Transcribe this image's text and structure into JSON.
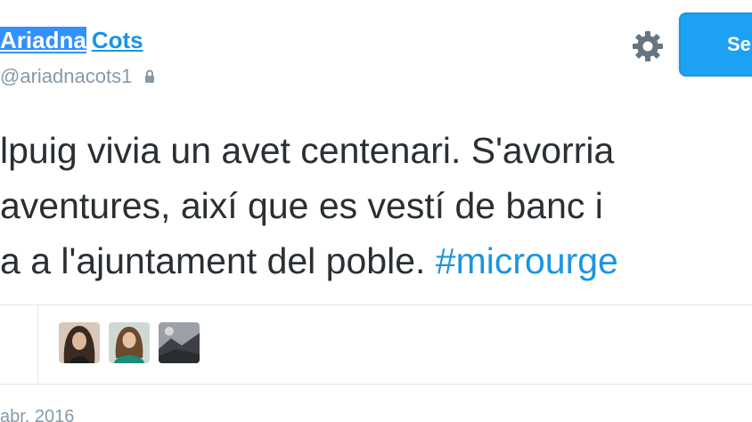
{
  "header": {
    "display_name_first": "Ariadna",
    "display_name_last": "Cots",
    "handle": "@ariadnacots1",
    "follow_label": "Se"
  },
  "tweet": {
    "lines": [
      "lpuig vivia un avet centenari. S'avorria",
      " aventures, així que es vestí de banc i",
      "a a l'ajuntament del poble. "
    ],
    "hashtag": "#microurge"
  },
  "likers": [
    {
      "name": "avatar-1",
      "colors": [
        "#3a2a20",
        "#e0b89a"
      ]
    },
    {
      "name": "avatar-2",
      "colors": [
        "#6b4a2e",
        "#1e8a7a"
      ]
    },
    {
      "name": "avatar-3",
      "colors": [
        "#9aa0a6",
        "#3d4145"
      ]
    }
  ],
  "date": "abr. 2016",
  "colors": {
    "link": "#1b95e0",
    "follow_bg": "#1da1f2",
    "muted": "#8899a6",
    "text": "#292f33",
    "divider": "#e1e8ed"
  }
}
